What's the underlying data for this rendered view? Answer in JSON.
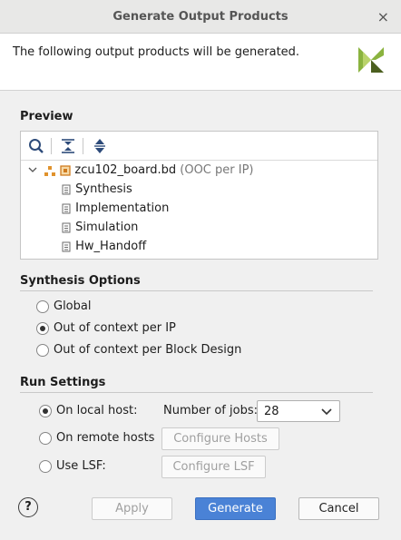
{
  "window": {
    "title": "Generate Output Products",
    "close_glyph": "×"
  },
  "header": {
    "message": "The following output products will be generated."
  },
  "preview": {
    "label": "Preview",
    "toolbar": [
      {
        "name": "search-icon"
      },
      {
        "name": "collapse-all-icon"
      },
      {
        "name": "expand-all-icon"
      }
    ],
    "root": {
      "label": "zcu102_board.bd",
      "suffix": "(OOC per IP)"
    },
    "children": [
      "Synthesis",
      "Implementation",
      "Simulation",
      "Hw_Handoff"
    ]
  },
  "synthesis_options": {
    "label": "Synthesis Options",
    "options": [
      {
        "label": "Global",
        "selected": false
      },
      {
        "label": "Out of context per IP",
        "selected": true
      },
      {
        "label": "Out of context per Block Design",
        "selected": false
      }
    ]
  },
  "run_settings": {
    "label": "Run Settings",
    "local_host": {
      "label": "On local host:",
      "selected": true
    },
    "jobs_label": "Number of jobs:",
    "jobs_value": "28",
    "remote_hosts": {
      "label": "On remote hosts",
      "selected": false,
      "button": "Configure Hosts"
    },
    "lsf": {
      "label": "Use LSF:",
      "selected": false,
      "button": "Configure LSF"
    }
  },
  "footer": {
    "help_glyph": "?",
    "apply": "Apply",
    "generate": "Generate",
    "cancel": "Cancel"
  },
  "colors": {
    "accent": "#4a82d6",
    "logo_green": "#8ab33f",
    "logo_dark": "#4b5f1f",
    "bd_icon": "#e0922c"
  }
}
